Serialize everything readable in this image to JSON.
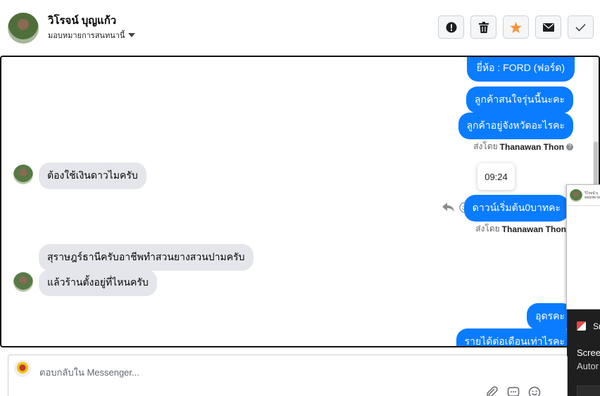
{
  "header": {
    "contact_name": "วิโรจน์ บุญแก้ว",
    "assign_label": "มอบหมายการสนทนานี้",
    "actions": [
      {
        "name": "spam",
        "icon": "exclamation-icon"
      },
      {
        "name": "delete",
        "icon": "trash-icon"
      },
      {
        "name": "star",
        "icon": "star-icon"
      },
      {
        "name": "unread",
        "icon": "envelope-icon"
      },
      {
        "name": "done",
        "icon": "check-icon"
      }
    ]
  },
  "thread": {
    "messages": {
      "out_1": "ยี่ห้อ : FORD (ฟอร์ด)",
      "out_2": "ลูกค้าสนใจรุ่นนี้นะคะ",
      "out_3": "ลูกค้าอยู่จังหวัดอะไรคะ",
      "in_1": "ต้องใช้เงินดาวไมครับ",
      "out_4": "ดาวน์เริ่มต้น0บาทคะ",
      "in_2": "สุราษฎร์ธานีครับอาชีพทำสวนยางสวนปามครับ",
      "in_3": "แล้วร้านตั้งอยู่ที่ไหนครับ",
      "out_5": "อุดรคะ",
      "out_6": "รายได้ต่อเดือนเท่าไรคะ"
    },
    "sent_by_prefix": "ส่งโดย",
    "sent_by_name": "Thanawan Thon",
    "timestamp": "09:24"
  },
  "popup": {
    "line1": "วิโรจน์ บุ",
    "line2": "มอบหมาย"
  },
  "notification": {
    "app": "Sn",
    "title": "Scree",
    "subtitle": "Autor"
  },
  "composer": {
    "placeholder": "ตอบกลับใน Messenger..."
  },
  "colors": {
    "accent": "#0a7cff",
    "incoming_bubble": "#e4e6eb",
    "star": "#f7923a"
  }
}
